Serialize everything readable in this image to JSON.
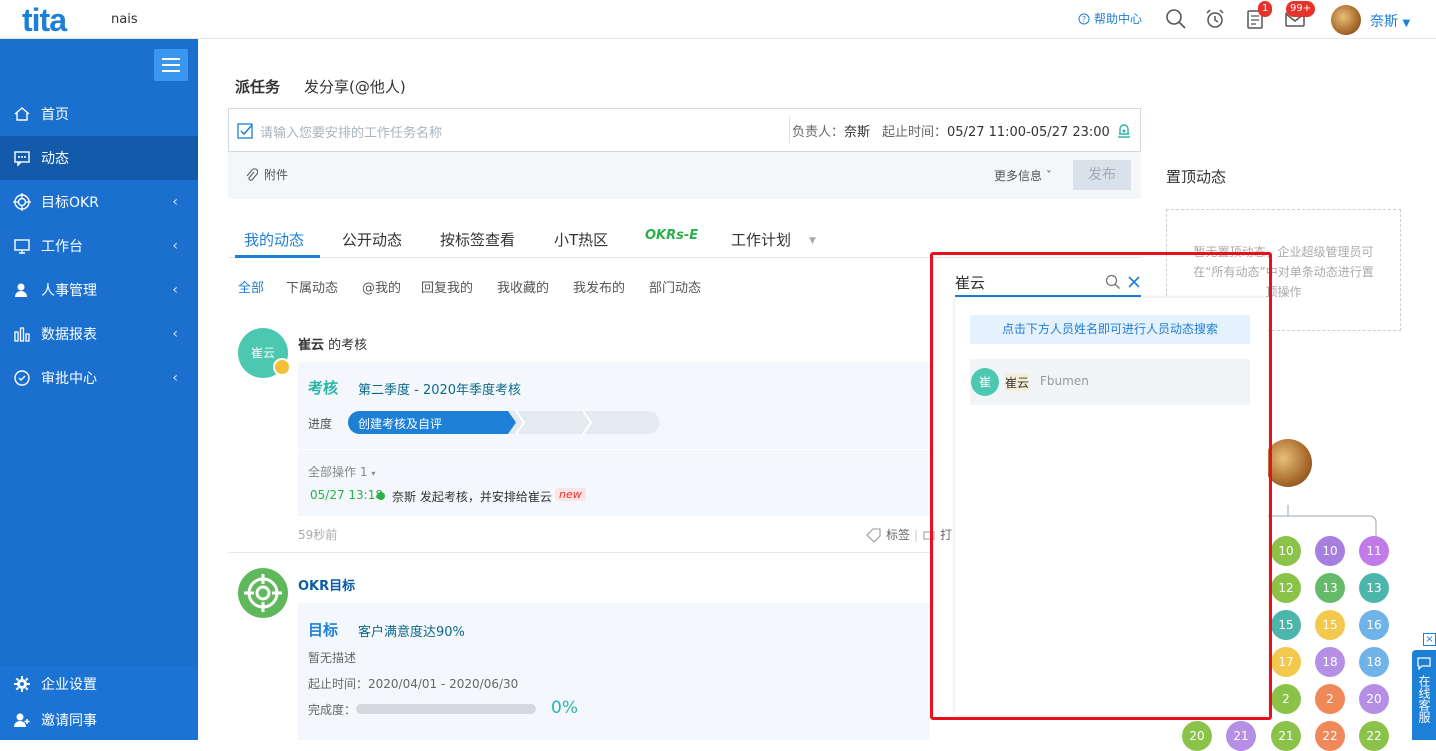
{
  "topbar": {
    "logo": "tita",
    "company": "nais",
    "help_label": "帮助中心",
    "badge_tasks": "1",
    "badge_messages": "99+",
    "user_name": "奈斯"
  },
  "sidebar": {
    "items": [
      {
        "label": "首页",
        "icon": "home-icon"
      },
      {
        "label": "动态",
        "icon": "message-icon"
      },
      {
        "label": "目标OKR",
        "icon": "target-icon"
      },
      {
        "label": "工作台",
        "icon": "monitor-icon"
      },
      {
        "label": "人事管理",
        "icon": "person-icon"
      },
      {
        "label": "数据报表",
        "icon": "bar-chart-icon"
      },
      {
        "label": "审批中心",
        "icon": "approval-icon"
      }
    ],
    "bottom": [
      {
        "label": "企业设置",
        "icon": "gear-icon"
      },
      {
        "label": "邀请同事",
        "icon": "person-add-icon"
      }
    ]
  },
  "composer": {
    "tab_task": "派任务",
    "tab_share": "发分享(@他人)",
    "placeholder": "请输入您要安排的工作任务名称",
    "owner_label": "负责人：",
    "owner": "奈斯",
    "time_label": "起止时间：",
    "time": "05/27 11:00-05/27 23:00",
    "attach_label": "附件",
    "more_label": "更多信息",
    "publish_label": "发布"
  },
  "feed_tabs": [
    "我的动态",
    "公开动态",
    "按标签查看",
    "小T热区",
    "工作计划"
  ],
  "okrs_logo": "OKRs-E",
  "sub_tabs": [
    "全部",
    "下属动态",
    "@我的",
    "回复我的",
    "我收藏的",
    "我发布的",
    "部门动态"
  ],
  "post1": {
    "avatar_text": "崔云",
    "author": "崔云",
    "action": " 的考核",
    "type_label": "考核",
    "title": "第二季度 - 2020年季度考核",
    "progress_label": "进度",
    "step1": "创建考核及自评",
    "ops_label": "全部操作",
    "ops_count": "1",
    "log_time": "05/27 13:18",
    "log_text": "奈斯 发起考核，并安排给崔云",
    "new_badge": "new",
    "ago": "59秒前",
    "tag_label": "标签",
    "more_partial": "打"
  },
  "post2": {
    "author": "OKR目标",
    "type_label": "目标",
    "title": "客户满意度达90%",
    "desc": "暂无描述",
    "period_label": "起止时间：",
    "period": "2020/04/01 - 2020/06/30",
    "complete_label": "完成度：",
    "percent": "0%",
    "progress": 0
  },
  "search_popup": {
    "query": "崔云",
    "hint": "点击下方人员姓名即可进行人员动态搜索",
    "result_avatar": "崔",
    "result_name": "崔云",
    "result_dept": "Fbumen"
  },
  "pinned": {
    "title": "置顶动态",
    "empty_text_1": "暂无置顶动态，企业超级管理员可",
    "empty_text_2": "在“所有动态”中对单条动态进行置",
    "empty_text_3": "顶操作"
  },
  "chart_numbers": [
    {
      "v": "10",
      "c": "#8bc34a"
    },
    {
      "v": "10",
      "c": "#a77fe0"
    },
    {
      "v": "11",
      "c": "#c07be8"
    },
    {
      "v": "12",
      "c": "#8bc34a"
    },
    {
      "v": "13",
      "c": "#66bb6a"
    },
    {
      "v": "13",
      "c": "#4db6ac"
    },
    {
      "v": "15",
      "c": "#4db6ac"
    },
    {
      "v": "15",
      "c": "#f2c94c"
    },
    {
      "v": "16",
      "c": "#6fb3e8"
    },
    {
      "v": "17",
      "c": "#f2c94c"
    },
    {
      "v": "18",
      "c": "#b58ee6"
    },
    {
      "v": "18",
      "c": "#6fb3e8"
    },
    {
      "v": "2",
      "c": "#8bc34a"
    },
    {
      "v": "2",
      "c": "#f0895a"
    },
    {
      "v": "20",
      "c": "#b58ee6"
    },
    {
      "v": "20",
      "c": "#8bc34a"
    },
    {
      "v": "21",
      "c": "#b58ee6"
    },
    {
      "v": "21",
      "c": "#8bc34a"
    },
    {
      "v": "22",
      "c": "#f0895a"
    },
    {
      "v": "22",
      "c": "#8bc34a"
    }
  ],
  "service_label": "在线客服"
}
